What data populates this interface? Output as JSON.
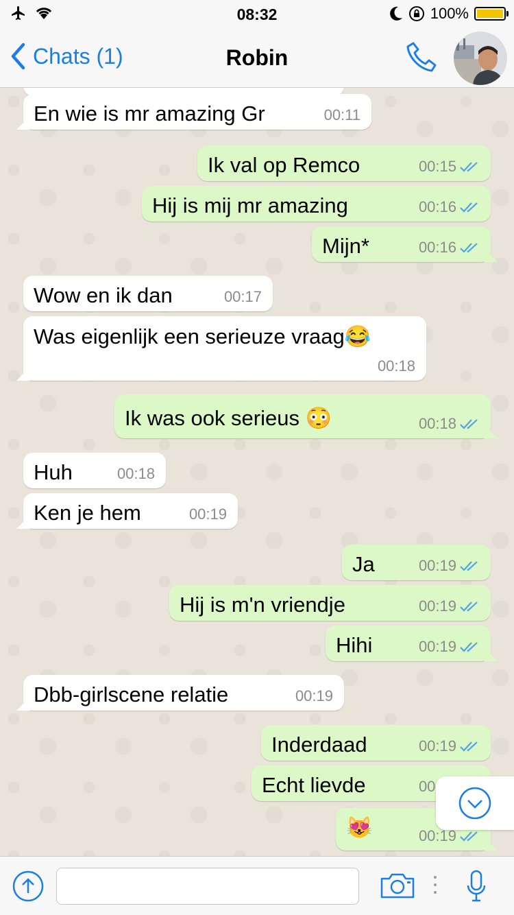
{
  "status_bar": {
    "time": "08:32",
    "battery": "100%"
  },
  "header": {
    "back_label": "Chats (1)",
    "contact_name": "Robin"
  },
  "messages": [
    {
      "dir": "in",
      "text": "En wie is mr amazing Gr",
      "time": "00:11"
    },
    {
      "dir": "out",
      "text": "Ik val op Remco",
      "time": "00:15",
      "read": true
    },
    {
      "dir": "out",
      "text": "Hij is mij mr amazing",
      "time": "00:16",
      "read": true
    },
    {
      "dir": "out",
      "text": "Mijn*",
      "time": "00:16",
      "read": true
    },
    {
      "dir": "in",
      "text": "Wow en ik dan",
      "time": "00:17"
    },
    {
      "dir": "in",
      "text": "Was eigenlijk een serieuze vraag😂",
      "time": "00:18"
    },
    {
      "dir": "out",
      "text": "Ik was ook serieus 😳",
      "time": "00:18",
      "read": true
    },
    {
      "dir": "in",
      "text": "Huh",
      "time": "00:18"
    },
    {
      "dir": "in",
      "text": "Ken je hem",
      "time": "00:19"
    },
    {
      "dir": "out",
      "text": "Ja",
      "time": "00:19",
      "read": true
    },
    {
      "dir": "out",
      "text": "Hij is m'n vriendje",
      "time": "00:19",
      "read": true
    },
    {
      "dir": "out",
      "text": "Hihi",
      "time": "00:19",
      "read": true
    },
    {
      "dir": "in",
      "text": "Dbb-girlscene relatie",
      "time": "00:19"
    },
    {
      "dir": "out",
      "text": "Inderdaad",
      "time": "00:19",
      "read": true
    },
    {
      "dir": "out",
      "text": "Echt lievde",
      "time": "00:19",
      "read": true
    },
    {
      "dir": "out",
      "text": "😻",
      "time": "00:19",
      "read": true
    }
  ],
  "colors": {
    "accent": "#1a7ee6",
    "outgoing": "#dcf8c6",
    "incoming": "#ffffff",
    "tick": "#4fa3e6"
  },
  "icons": [
    "airplane-icon",
    "wifi-icon",
    "moon-icon",
    "rotation-lock-icon",
    "battery-icon",
    "back-chevron-icon",
    "phone-icon",
    "chevron-down-icon",
    "share-icon",
    "camera-icon",
    "microphone-icon"
  ]
}
